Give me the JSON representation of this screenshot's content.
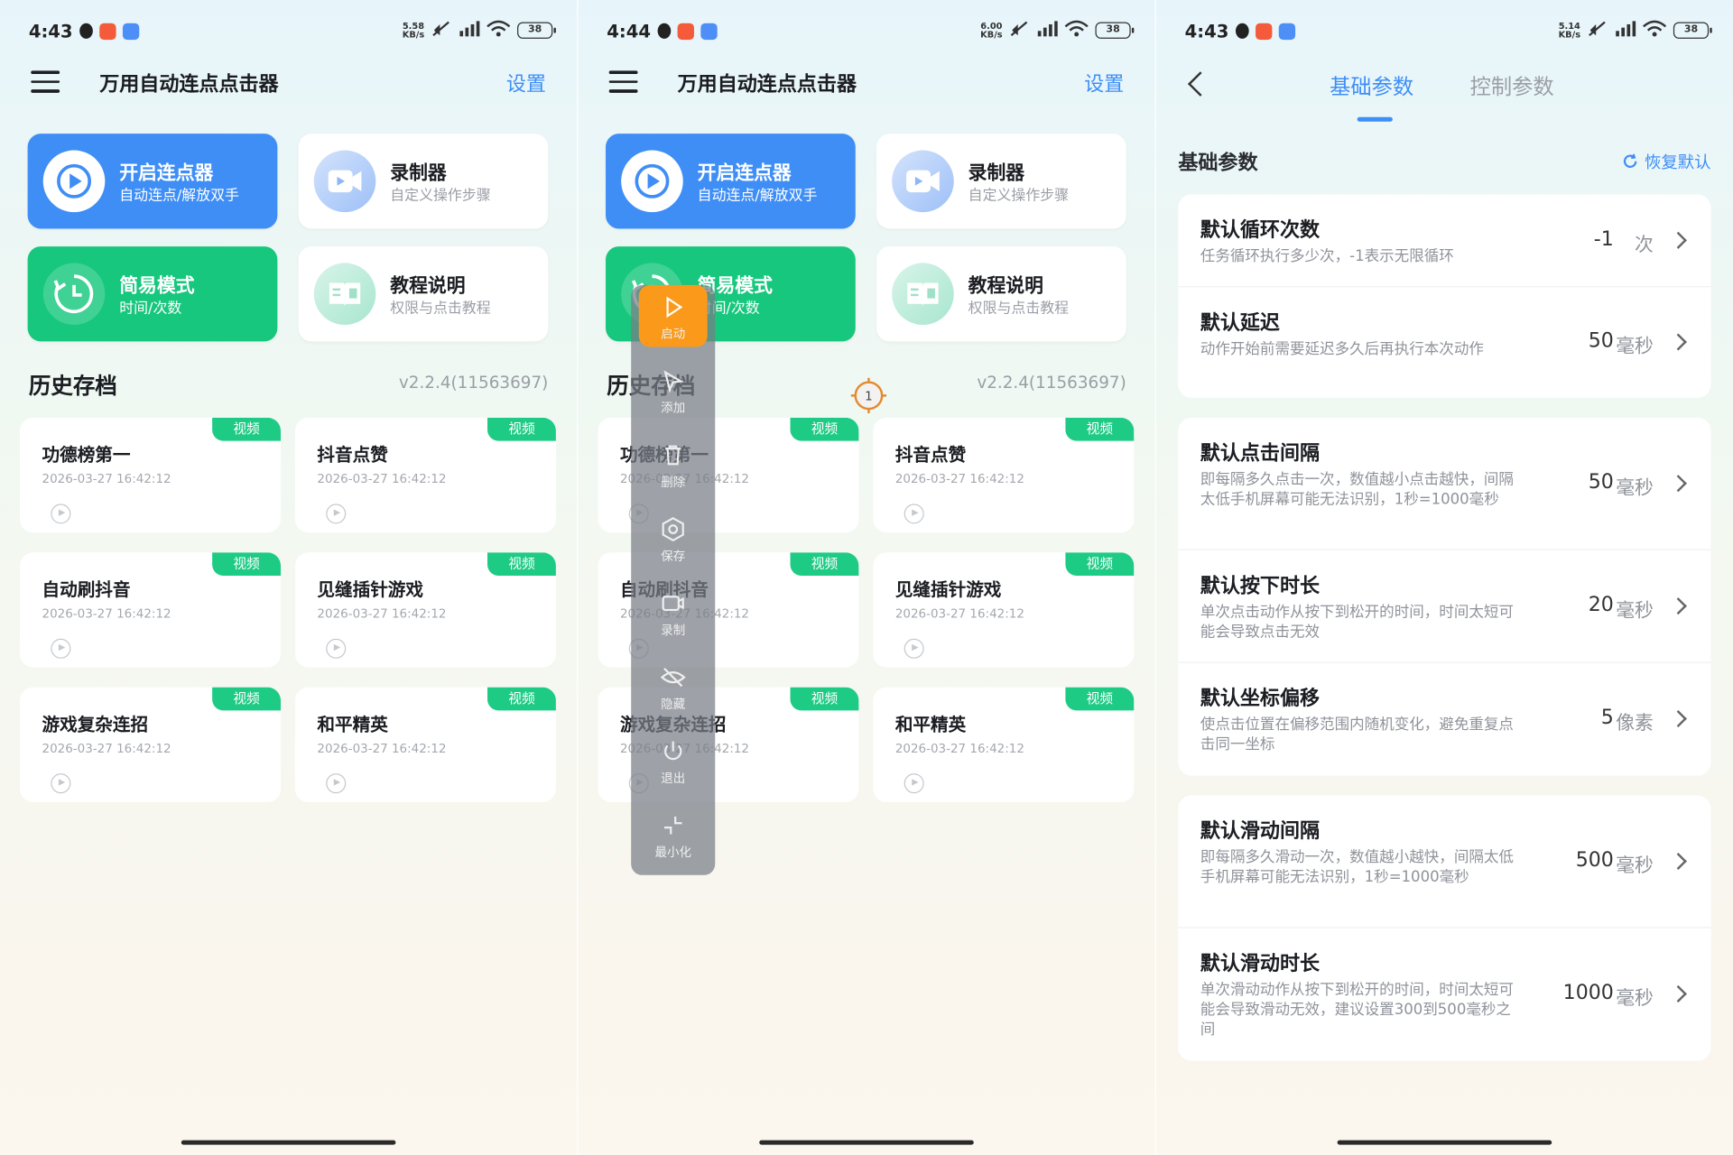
{
  "status_bars": [
    {
      "time": "4:43",
      "net_speed": "5.58",
      "net_unit": "KB/s",
      "battery": "38"
    },
    {
      "time": "4:44",
      "net_speed": "6.00",
      "net_unit": "KB/s",
      "battery": "38"
    },
    {
      "time": "4:43",
      "net_speed": "5.14",
      "net_unit": "KB/s",
      "battery": "38"
    }
  ],
  "home": {
    "title": "万用自动连点点击器",
    "settings_label": "设置",
    "features": [
      {
        "title": "开启连点器",
        "subtitle": "自动连点/解放双手",
        "icon": "play-circle-icon",
        "color": "#3f8ef6"
      },
      {
        "title": "录制器",
        "subtitle": "自定义操作步骤",
        "icon": "video-camera-icon",
        "color": "#ffffff"
      },
      {
        "title": "简易模式",
        "subtitle": "时间/次数",
        "icon": "timer-icon",
        "color": "#17c77d"
      },
      {
        "title": "教程说明",
        "subtitle": "权限与点击教程",
        "icon": "book-icon",
        "color": "#ffffff"
      }
    ],
    "history_title": "历史存档",
    "version": "v2.2.4(11563697)",
    "history": [
      {
        "name": "功德榜第一",
        "date": "2026-03-27 16:42:12",
        "badge": "视频"
      },
      {
        "name": "抖音点赞",
        "date": "2026-03-27 16:42:12",
        "badge": "视频"
      },
      {
        "name": "自动刷抖音",
        "date": "2026-03-27 16:42:12",
        "badge": "视频"
      },
      {
        "name": "见缝插针游戏",
        "date": "2026-03-27 16:42:12",
        "badge": "视频"
      },
      {
        "name": "游戏复杂连招",
        "date": "2026-03-27 16:42:12",
        "badge": "视频"
      },
      {
        "name": "和平精英",
        "date": "2026-03-27 16:42:12",
        "badge": "视频"
      }
    ]
  },
  "floating_toolbar": {
    "items": [
      {
        "label": "启动",
        "icon": "play-icon",
        "active": true
      },
      {
        "label": "添加",
        "icon": "add-pointer-icon"
      },
      {
        "label": "删除",
        "icon": "delete-icon"
      },
      {
        "label": "保存",
        "icon": "save-icon"
      },
      {
        "label": "录制",
        "icon": "record-icon"
      },
      {
        "label": "隐藏",
        "icon": "hide-icon"
      },
      {
        "label": "退出",
        "icon": "power-icon"
      },
      {
        "label": "最小化",
        "icon": "minimize-icon"
      }
    ],
    "marker_label": "1"
  },
  "params": {
    "tabs": [
      "基础参数",
      "控制参数"
    ],
    "active_tab": "基础参数",
    "section_title": "基础参数",
    "reset_label": "恢复默认",
    "groups": [
      [
        {
          "title": "默认循环次数",
          "desc": "任务循环执行多少次，-1表示无限循环",
          "value": "-1",
          "unit": "次"
        },
        {
          "title": "默认延迟",
          "desc": "动作开始前需要延迟多久后再执行本次动作",
          "value": "50",
          "unit": "毫秒"
        }
      ],
      [
        {
          "title": "默认点击间隔",
          "desc": "即每隔多久点击一次，数值越小点击越快，间隔太低手机屏幕可能无法识别，1秒=1000毫秒",
          "value": "50",
          "unit": "毫秒"
        },
        {
          "title": "默认按下时长",
          "desc": "单次点击动作从按下到松开的时间，时间太短可能会导致点击无效",
          "value": "20",
          "unit": "毫秒"
        },
        {
          "title": "默认坐标偏移",
          "desc": "使点击位置在偏移范围内随机变化，避免重复点击同一坐标",
          "value": "5",
          "unit": "像素"
        }
      ],
      [
        {
          "title": "默认滑动间隔",
          "desc": "即每隔多久滑动一次，数值越小越快，间隔太低手机屏幕可能无法识别，1秒=1000毫秒",
          "value": "500",
          "unit": "毫秒"
        },
        {
          "title": "默认滑动时长",
          "desc": "单次滑动动作从按下到松开的时间，时间太短可能会导致滑动无效，建议设置300到500毫秒之间",
          "value": "1000",
          "unit": "毫秒"
        }
      ]
    ]
  }
}
